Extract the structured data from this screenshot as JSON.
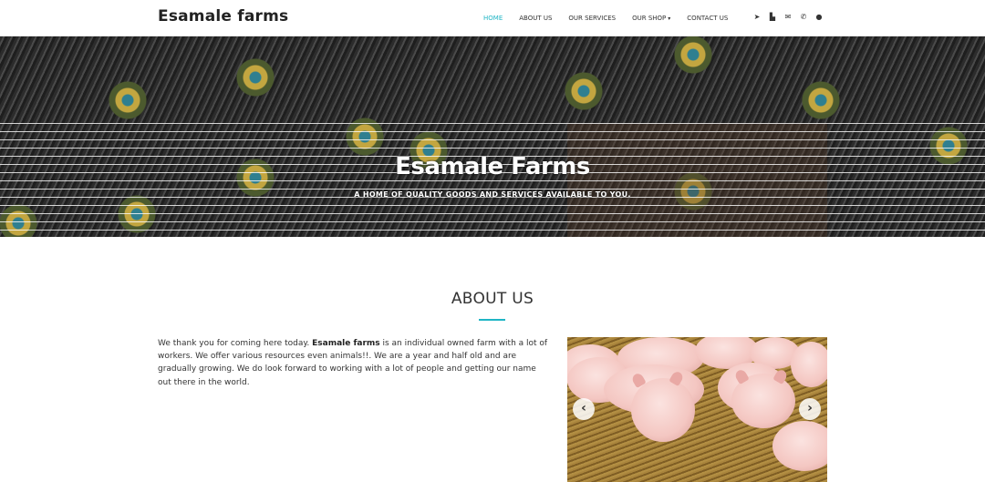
{
  "navbar": {
    "brand": "Esamale farms",
    "links": [
      {
        "label": "HOME",
        "active": true
      },
      {
        "label": "ABOUT US",
        "active": false
      },
      {
        "label": "OUR SERVICES",
        "active": false
      },
      {
        "label": "OUR SHOP",
        "active": false,
        "has_dropdown": true
      },
      {
        "label": "CONTACT US",
        "active": false
      }
    ],
    "icons": [
      {
        "name": "location-arrow-icon",
        "glyph": "➤"
      },
      {
        "name": "cart-icon",
        "glyph": "▙"
      },
      {
        "name": "envelope-icon",
        "glyph": "✉"
      },
      {
        "name": "phone-icon",
        "glyph": "✆"
      },
      {
        "name": "user-icon",
        "glyph": "●"
      }
    ],
    "dropdown_caret": "▾",
    "accent_color": "#1fb5c5"
  },
  "hero": {
    "title": "Esamale Farms",
    "subtitle": "A HOME OF QUALITY GOODS AND SERVICES AVAILABLE TO YOU."
  },
  "about": {
    "heading": "ABOUT US",
    "text_before_bold": "We thank you for coming here today. ",
    "bold_name": "Esamale farms",
    "text_after_bold": " is an individual owned farm with a lot of workers. We offer various resources even animals!!. We are a year and half old and are gradually growing. We do look forward to working with a lot of people and getting our name out there in the world."
  },
  "carousel": {
    "prev_glyph": "‹",
    "next_glyph": "›"
  }
}
